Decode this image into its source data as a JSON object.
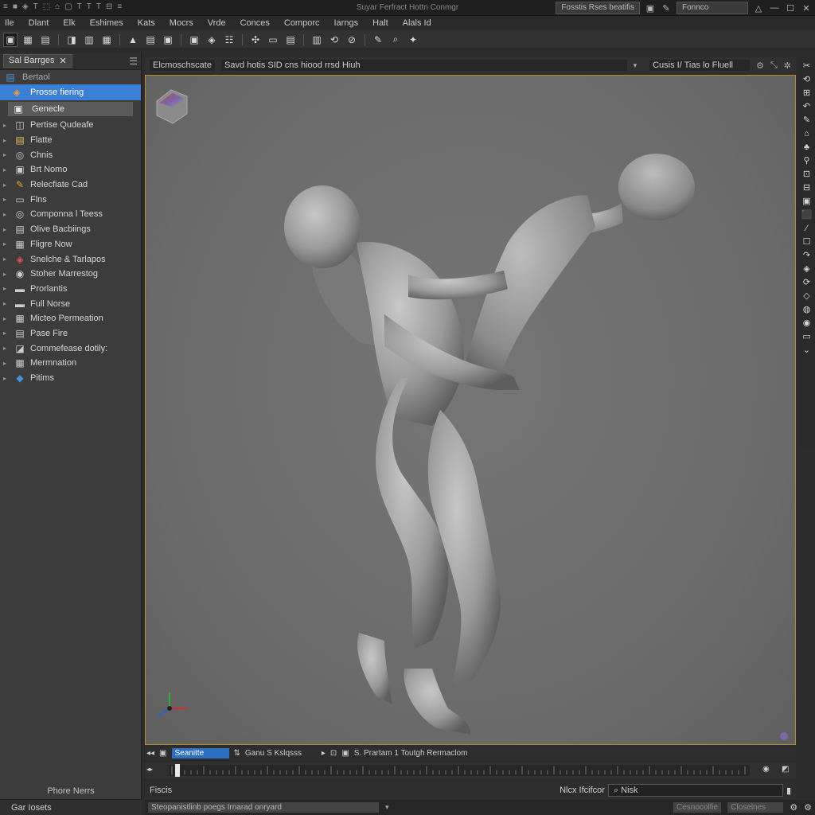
{
  "title_bar": {
    "title": "Suyar Ferfract Hottn Conmgr",
    "icons": [
      "≡",
      "■",
      "◈",
      "T",
      "⬚",
      "⌂",
      "▢",
      "T",
      "T",
      "T",
      "⊟",
      "≡"
    ],
    "field": "Fosstis Rses beatifis",
    "field_icons": [
      "▣",
      "✎"
    ],
    "search": "Fonnco",
    "warn_icon": "△",
    "buttons": [
      "—",
      "☐",
      "✕"
    ]
  },
  "menu": [
    "Ile",
    "Dlant",
    "Elk",
    "Eshimes",
    "Kats",
    "Mocrs",
    "Vrde",
    "Conces",
    "Comporc",
    "Iarngs",
    "Halt",
    "Alals Id"
  ],
  "toolbar_icons": [
    "▣",
    "▦",
    "▤",
    "◨",
    "▥",
    "▦",
    "▲",
    "▤",
    "▣",
    "▣",
    "◈",
    "☷",
    "✣",
    "▭",
    "▤",
    "▥",
    "⟲",
    "⊘",
    "✎",
    "⌕",
    "✦"
  ],
  "outliner": {
    "tab_label": "Sal Barrges",
    "tab_close": "✕",
    "menu_icon": "☰",
    "root": "Bertaol",
    "selected": "Prosse fiering",
    "sub": "Genecle",
    "items": [
      {
        "label": "Pertise Qudeafe",
        "icon": "◫"
      },
      {
        "label": "Flatte",
        "icon": "▤"
      },
      {
        "label": "Chnis",
        "icon": "◎"
      },
      {
        "label": "Brt Nomo",
        "icon": "▣"
      },
      {
        "label": "Relecfiate Cad",
        "icon": "✎"
      },
      {
        "label": "Flns",
        "icon": "▭"
      },
      {
        "label": "Componna l Teess",
        "icon": "◎"
      },
      {
        "label": "Olive Bacbiings",
        "icon": "▤"
      },
      {
        "label": "Fligre Now",
        "icon": "▦"
      },
      {
        "label": "Snelche & Tarlapos",
        "icon": "◈"
      },
      {
        "label": "Stoher Marrestog",
        "icon": "◉"
      },
      {
        "label": "Prorlantis",
        "icon": "▬"
      },
      {
        "label": "Full Norse",
        "icon": "▬"
      },
      {
        "label": "Micteo Permeation",
        "icon": "▦"
      },
      {
        "label": "Pase Fire",
        "icon": "▤"
      },
      {
        "label": "Commefease dotily:",
        "icon": "◪"
      },
      {
        "label": "Mermnation",
        "icon": "▦"
      },
      {
        "label": "Pitims",
        "icon": "◆"
      }
    ],
    "footer_label": "Phore Nerrs",
    "footer": "Gar Iosets"
  },
  "viewport_header": {
    "field": "Elcmoschscate",
    "scene": "Savd hotis SID cns hiood rrsd Hiuh",
    "view": "Cusis I/ Tias lo Fluell",
    "icons": [
      "⚙",
      "⤡",
      "✲"
    ]
  },
  "right_tools": [
    "✂",
    "⟲",
    "⊞",
    "↶",
    "✎",
    "⌂",
    "♣",
    "⚲",
    "⊡",
    "⊟",
    "▣",
    "⬛",
    "∕",
    "☐",
    "↷",
    "◈",
    "⟳",
    "◇",
    "◍",
    "◉",
    "▭",
    "⌄"
  ],
  "timeline": {
    "icons": [
      "◂◂",
      "▣",
      "⇅",
      "⊡",
      "▣"
    ],
    "field": "Seanitte",
    "camera": "Ganu S Kslqsss",
    "dd": "▸",
    "info": "S. Prartam 1 Toutgh Rermaclom",
    "ruler_icons": [
      "◂▸",
      "◉",
      "◩"
    ]
  },
  "bottom": {
    "label": "Fiscis",
    "search_label": "Nlcx Ifcifcor",
    "search_value": "Nisk",
    "search_icon": "⌕",
    "clear": "▮"
  },
  "status": {
    "text": "Steopanistlinb poegs Irnarad onryard",
    "dd": "▾",
    "right1": "Cesnocolfie",
    "right2": "Closelnes",
    "icons": [
      "⚙",
      "⚙"
    ]
  }
}
